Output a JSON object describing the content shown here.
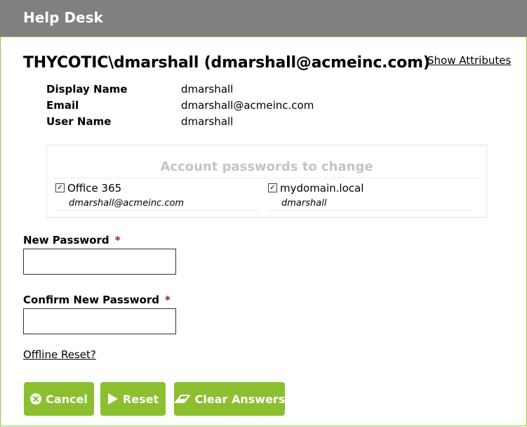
{
  "header": {
    "title": "Help Desk"
  },
  "user": {
    "heading": "THYCOTIC\\dmarshall (dmarshall@acmeinc.com)",
    "show_attributes_label": "Show Attributes",
    "details": [
      {
        "label": "Display Name",
        "value": "dmarshall"
      },
      {
        "label": "Email",
        "value": "dmarshall@acmeinc.com"
      },
      {
        "label": "User Name",
        "value": "dmarshall"
      }
    ]
  },
  "accounts": {
    "heading": "Account passwords to change",
    "items": [
      {
        "name": "Office 365",
        "user": "dmarshall@acmeinc.com",
        "checked": true
      },
      {
        "name": "mydomain.local",
        "user": "dmarshall",
        "checked": true
      }
    ]
  },
  "form": {
    "new_password_label": "New Password",
    "confirm_password_label": "Confirm New Password",
    "required_marker": "*",
    "new_password_value": "",
    "confirm_password_value": "",
    "offline_reset_label": "Offline Reset?"
  },
  "buttons": {
    "cancel_label": "Cancel",
    "reset_label": "Reset",
    "clear_answers_label": "Clear Answers"
  },
  "colors": {
    "header_bg": "#808080",
    "accent_green": "#8cbf2f",
    "required_red": "#8b1a1a"
  },
  "icons": {
    "cancel": "x-icon",
    "reset": "play-icon",
    "clear": "eraser-icon",
    "checkbox": "checkbox-checked-icon"
  }
}
